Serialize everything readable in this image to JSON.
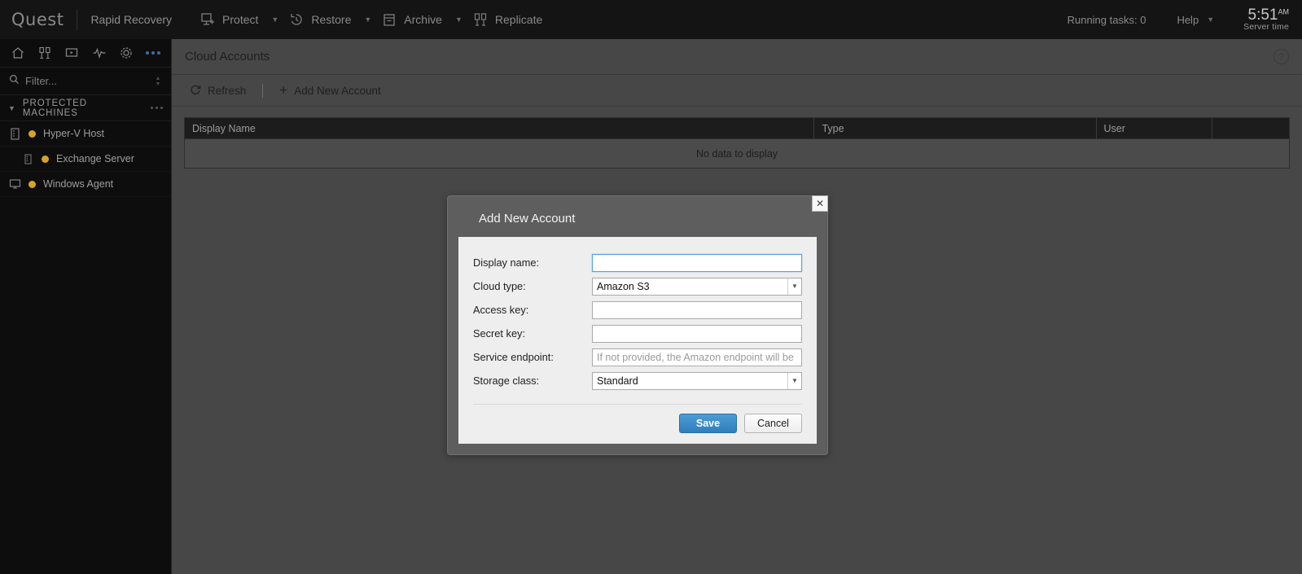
{
  "topbar": {
    "logo": "Quest",
    "product": "Rapid Recovery",
    "nav": [
      {
        "label": "Protect",
        "icon": "protect-icon",
        "caret": true
      },
      {
        "label": "Restore",
        "icon": "restore-icon",
        "caret": true
      },
      {
        "label": "Archive",
        "icon": "archive-icon",
        "caret": true
      },
      {
        "label": "Replicate",
        "icon": "replicate-icon",
        "caret": false
      }
    ],
    "running_tasks": "Running tasks: 0",
    "help": "Help",
    "time": "5:51",
    "ampm": "AM",
    "server_time": "Server time"
  },
  "sidebar": {
    "icons": [
      "home-icon",
      "machines-icon",
      "monitor-icon",
      "events-icon",
      "settings-icon",
      "more-icon"
    ],
    "filter": {
      "placeholder": "Filter...",
      "value": ""
    },
    "group": {
      "title": "PROTECTED MACHINES"
    },
    "machines": [
      {
        "label": "Hyper-V Host",
        "status_color": "#d9a227",
        "icon": "server-icon",
        "indent": false
      },
      {
        "label": "Exchange Server",
        "status_color": "#d9a227",
        "icon": "server-icon",
        "indent": true
      },
      {
        "label": "Windows Agent",
        "status_color": "#d9a227",
        "icon": "desktop-icon",
        "indent": false
      }
    ]
  },
  "page": {
    "title": "Cloud Accounts",
    "help_icon": "?",
    "toolbar": {
      "refresh": "Refresh",
      "add_new_account": "Add New Account"
    },
    "table": {
      "columns": [
        "Display Name",
        "Type",
        "User",
        ""
      ],
      "empty_message": "No data to display",
      "rows": []
    }
  },
  "dialog": {
    "title": "Add New Account",
    "close": "✕",
    "fields": [
      {
        "label": "Display name:",
        "type": "text",
        "value": "",
        "placeholder": "",
        "focused": true
      },
      {
        "label": "Cloud type:",
        "type": "select",
        "value": "Amazon S3"
      },
      {
        "label": "Access key:",
        "type": "text",
        "value": "",
        "placeholder": "",
        "focused": false
      },
      {
        "label": "Secret key:",
        "type": "text",
        "value": "",
        "placeholder": "",
        "focused": false
      },
      {
        "label": "Service endpoint:",
        "type": "text",
        "value": "",
        "placeholder": "If not provided, the Amazon endpoint will be used",
        "focused": false
      },
      {
        "label": "Storage class:",
        "type": "select",
        "value": "Standard"
      }
    ],
    "save": "Save",
    "cancel": "Cancel"
  },
  "colors": {
    "accent_blue": "#2e7fbd",
    "status_amber": "#d9a227",
    "topbar_bg": "#141414",
    "sidebar_bg": "#0d0d0d",
    "content_bg": "#474747"
  }
}
